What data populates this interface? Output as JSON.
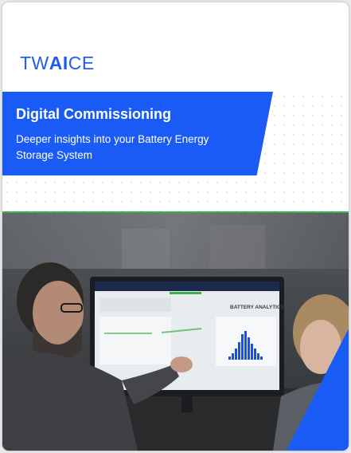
{
  "brand": {
    "logo_tw": "TW",
    "logo_ai": "AI",
    "logo_ce": "CE",
    "color": "#1f5cf5"
  },
  "banner": {
    "title": "Digital Commissioning",
    "subtitle": "Deeper insights into your Battery Energy Storage System",
    "color": "#1a5bf5"
  },
  "photo": {
    "monitor_heading": "BATTERY ANALYTICS",
    "accent_line_color": "#3bb249"
  }
}
